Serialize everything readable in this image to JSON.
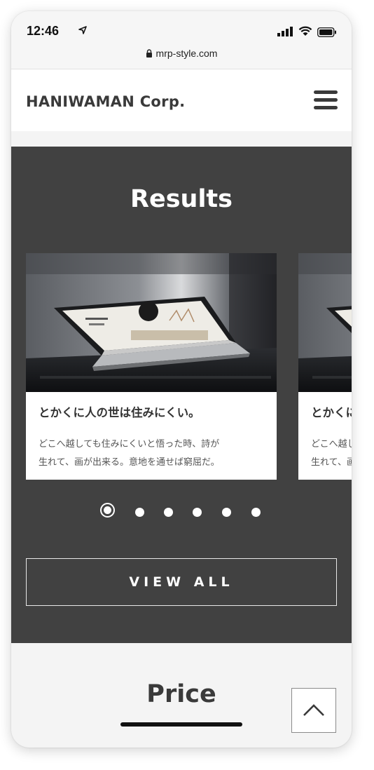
{
  "status_bar": {
    "time": "12:46",
    "url": "mrp-style.com"
  },
  "header": {
    "logo": "HANIWAMAN Corp."
  },
  "results": {
    "title": "Results",
    "cards": [
      {
        "title": "とかくに人の世は住みにくい。",
        "body_line1": "どこへ越しても住みにくいと悟った時、詩が",
        "body_line2": "生れて、画が出来る。意地を通せば窮屈だ。"
      },
      {
        "title": "とかくに人の世は住みにくい。",
        "body_line1": "どこへ越しても住みにくいと悟った時、詩が",
        "body_line2": "生れて、画が出来る。意地を通せば窮屈だ。"
      }
    ],
    "pagination": {
      "total": 6,
      "active": 1
    },
    "view_all_label": "VIEW ALL"
  },
  "price": {
    "title": "Price"
  },
  "icons": {
    "lock": "lock-icon",
    "location": "location-arrow-icon",
    "signal": "signal-icon",
    "wifi": "wifi-icon",
    "battery": "battery-icon",
    "menu": "hamburger-menu-icon",
    "back_to_top": "chevron-up-icon"
  },
  "colors": {
    "section_dark": "#414141",
    "background_light": "#f4f4f4",
    "logo_text": "#3a3a3a"
  }
}
